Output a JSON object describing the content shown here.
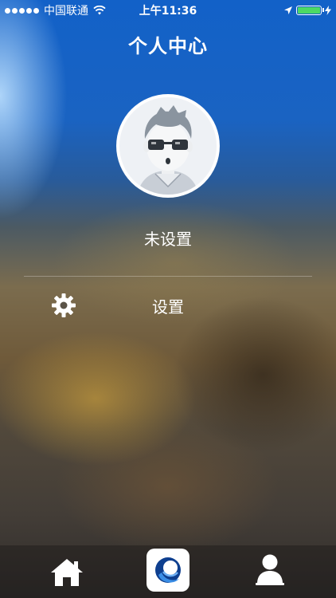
{
  "status_bar": {
    "carrier": "中国联通",
    "time": "上午11:36",
    "signal_bars_filled": 5,
    "battery_level": 1.0
  },
  "header": {
    "title": "个人中心"
  },
  "profile": {
    "username": "未设置"
  },
  "menu": {
    "items": [
      {
        "label": "设置",
        "icon": "gear-icon"
      }
    ]
  },
  "tab_bar": {
    "tabs": [
      {
        "icon": "home-icon"
      },
      {
        "icon": "app-logo-icon"
      },
      {
        "icon": "profile-icon"
      }
    ]
  },
  "colors": {
    "battery_fill": "#4cd964",
    "accent_blue": "#1261c8"
  }
}
